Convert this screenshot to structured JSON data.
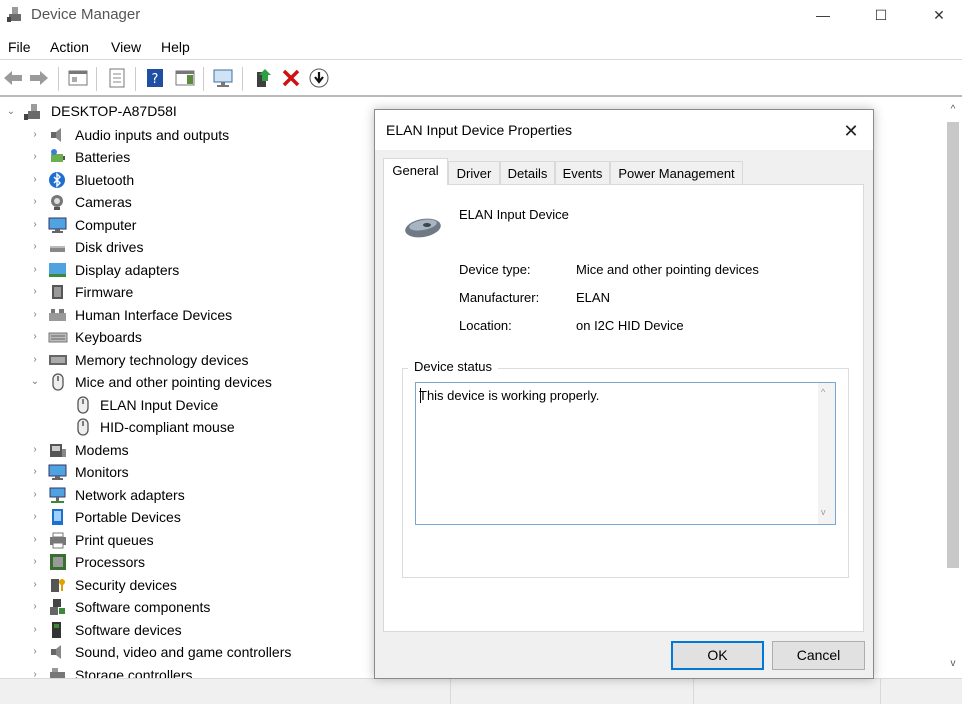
{
  "window": {
    "title": "Device Manager",
    "controls": {
      "minimize": "—",
      "maximize": "☐",
      "close": "✕"
    }
  },
  "menu": [
    "File",
    "Action",
    "View",
    "Help"
  ],
  "toolbar": [
    "back-icon",
    "forward-icon",
    "show-hide-tree-icon",
    "properties-icon",
    "help-icon",
    "action-pane-icon",
    "scan-hardware-icon",
    "update-driver-icon",
    "uninstall-icon",
    "download-icon"
  ],
  "tree": {
    "root": "DESKTOP-A87D58I",
    "categories": [
      {
        "label": "Audio inputs and outputs",
        "icon": "speaker-icon"
      },
      {
        "label": "Batteries",
        "icon": "battery-icon"
      },
      {
        "label": "Bluetooth",
        "icon": "bluetooth-icon"
      },
      {
        "label": "Cameras",
        "icon": "camera-icon"
      },
      {
        "label": "Computer",
        "icon": "monitor-icon"
      },
      {
        "label": "Disk drives",
        "icon": "disk-icon"
      },
      {
        "label": "Display adapters",
        "icon": "display-adapter-icon"
      },
      {
        "label": "Firmware",
        "icon": "chip-icon"
      },
      {
        "label": "Human Interface Devices",
        "icon": "hid-icon"
      },
      {
        "label": "Keyboards",
        "icon": "keyboard-icon"
      },
      {
        "label": "Memory technology devices",
        "icon": "memory-icon"
      },
      {
        "label": "Mice and other pointing devices",
        "icon": "mouse-icon",
        "expanded": true,
        "children": [
          {
            "label": "ELAN Input Device",
            "icon": "mouse-icon"
          },
          {
            "label": "HID-compliant mouse",
            "icon": "mouse-icon"
          }
        ]
      },
      {
        "label": "Modems",
        "icon": "modem-icon"
      },
      {
        "label": "Monitors",
        "icon": "monitor-icon"
      },
      {
        "label": "Network adapters",
        "icon": "network-icon"
      },
      {
        "label": "Portable Devices",
        "icon": "portable-icon"
      },
      {
        "label": "Print queues",
        "icon": "printer-icon"
      },
      {
        "label": "Processors",
        "icon": "processor-icon"
      },
      {
        "label": "Security devices",
        "icon": "security-icon"
      },
      {
        "label": "Software components",
        "icon": "component-icon"
      },
      {
        "label": "Software devices",
        "icon": "software-device-icon"
      },
      {
        "label": "Sound, video and game controllers",
        "icon": "speaker-icon"
      },
      {
        "label": "Storage controllers",
        "icon": "storage-icon"
      }
    ]
  },
  "dialog": {
    "title": "ELAN Input Device Properties",
    "close": "✕",
    "tabs": [
      "General",
      "Driver",
      "Details",
      "Events",
      "Power Management"
    ],
    "active_tab": "General",
    "device_name": "ELAN Input Device",
    "props": [
      {
        "label": "Device type:",
        "value": "Mice and other pointing devices"
      },
      {
        "label": "Manufacturer:",
        "value": "ELAN"
      },
      {
        "label": "Location:",
        "value": "on I2C HID Device"
      }
    ],
    "status_legend": "Device status",
    "status_text": "This device is working properly.",
    "ok": "OK",
    "cancel": "Cancel"
  },
  "colors": {
    "accent": "#0078d7",
    "dialog_bg": "#f0f0f0"
  }
}
